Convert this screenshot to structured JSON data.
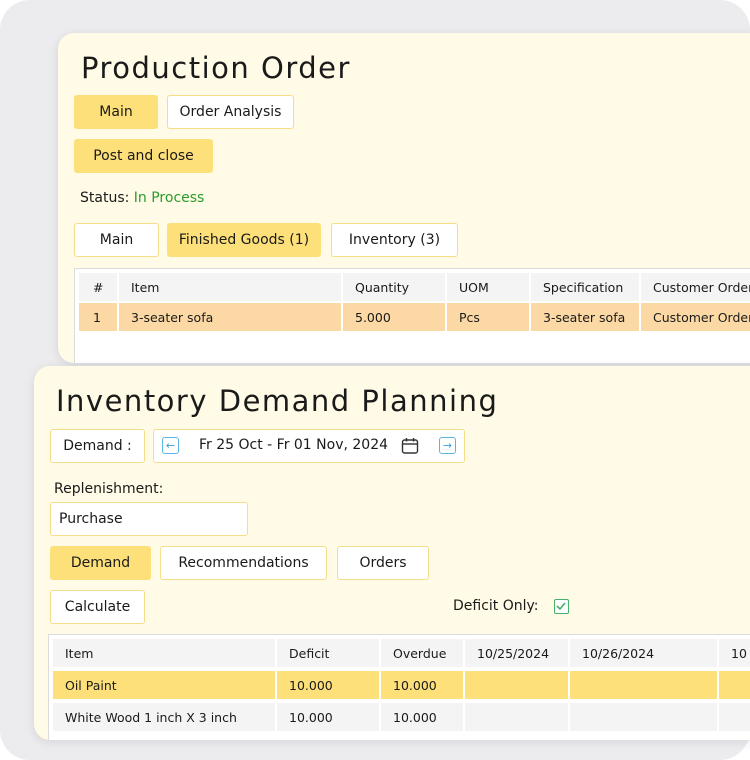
{
  "production_order": {
    "title": "Production Order",
    "tabs": {
      "main": "Main",
      "order_analysis": "Order Analysis"
    },
    "post_and_close": "Post and close",
    "status_label": "Status:",
    "status_value": "In Process",
    "status_color": "#2c9a2c",
    "subtabs": {
      "main": "Main",
      "finished_goods": "Finished Goods (1)",
      "inventory": "Inventory (3)"
    },
    "table": {
      "columns": [
        "#",
        "Item",
        "Quantity",
        "UOM",
        "Specification",
        "Customer Order"
      ],
      "rows": [
        [
          "1",
          "3-seater sofa",
          "5.000",
          "Pcs",
          "3-seater sofa",
          "Customer Order"
        ]
      ]
    }
  },
  "demand_planning": {
    "title": "Inventory Demand Planning",
    "demand_label": "Demand :",
    "period": "Fr 25 Oct - Fr 01 Nov, 2024",
    "replenishment_label": "Replenishment:",
    "replenishment_value": "Purchase",
    "tabs": {
      "demand": "Demand",
      "recommendations": "Recommendations",
      "orders": "Orders"
    },
    "calculate": "Calculate",
    "deficit_only_label": "Deficit Only:",
    "deficit_only_checked": true,
    "table": {
      "columns": [
        "Item",
        "Deficit",
        "Overdue",
        "10/25/2024",
        "10/26/2024",
        "10"
      ],
      "rows": [
        [
          "Oil Paint",
          "10.000",
          "10.000",
          "",
          "",
          ""
        ],
        [
          "White Wood 1 inch X 3 inch",
          "10.000",
          "10.000",
          "",
          "",
          ""
        ]
      ]
    }
  },
  "colors": {
    "accent_yellow": "#fde079",
    "panel_bg": "#fffbe6",
    "selected_row_orange": "#fcd9a4"
  }
}
